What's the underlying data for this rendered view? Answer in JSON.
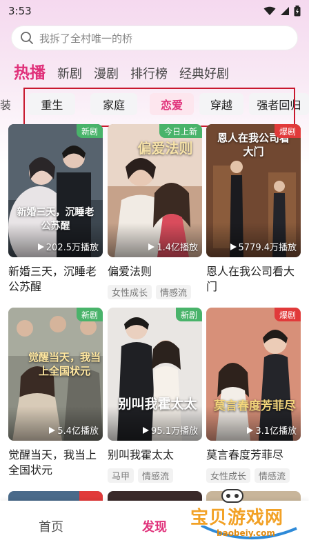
{
  "status_bar": {
    "time": "3:53"
  },
  "search": {
    "placeholder": "我拆了全村唯一的桥"
  },
  "main_tabs": [
    {
      "label": "热播",
      "active": true
    },
    {
      "label": "新剧"
    },
    {
      "label": "漫剧"
    },
    {
      "label": "排行榜"
    },
    {
      "label": "经典好剧"
    }
  ],
  "sub_categories": {
    "cut_label": "装",
    "items": [
      {
        "label": "重生"
      },
      {
        "label": "家庭"
      },
      {
        "label": "恋爱",
        "active": true
      },
      {
        "label": "穿越"
      },
      {
        "label": "强者回归"
      }
    ]
  },
  "cards": [
    {
      "title": "新婚三天，沉睡老公苏醒",
      "badge": "新剧",
      "badge_color": "#49b36a",
      "plays": "202.5万播放",
      "poster_text": "新婚三天，沉睡老公苏醒",
      "tags": []
    },
    {
      "title": "偏爱法则",
      "badge": "今日上新",
      "badge_color": "#49b36a",
      "plays": "1.4亿播放",
      "poster_text": "偏爱法则",
      "tags": [
        "女性成长",
        "情感流"
      ]
    },
    {
      "title": "恩人在我公司看大门",
      "badge": "爆剧",
      "badge_color": "#e13a3a",
      "plays": "5779.4万播放",
      "poster_text": "恩人在我公司看大门",
      "tags": []
    },
    {
      "title": "觉醒当天，我当上全国状元",
      "badge": "新剧",
      "badge_color": "#49b36a",
      "plays": "5.4亿播放",
      "poster_text": "觉醒当天，我当上全国状元",
      "tags": []
    },
    {
      "title": "别叫我霍太太",
      "badge": "新剧",
      "badge_color": "#49b36a",
      "plays": "95.1万播放",
      "poster_text": "别叫我霍太太",
      "tags": [
        "马甲",
        "情感流"
      ]
    },
    {
      "title": "莫言春度芳菲尽",
      "badge": "爆剧",
      "badge_color": "#e13a3a",
      "plays": "3.1亿播放",
      "poster_text": "莫言春度芳菲尽",
      "tags": [
        "女性成长",
        "情感流"
      ]
    }
  ],
  "bottom_nav": [
    {
      "label": "首页"
    },
    {
      "label": "发现",
      "active": true
    }
  ],
  "watermark": {
    "text": "宝贝游戏网",
    "url": "baobeiy.com"
  },
  "colors": {
    "accent": "#e0307a",
    "badge_green": "#49b36a",
    "badge_red": "#e13a3a",
    "annotation_box": "#c8182e"
  }
}
